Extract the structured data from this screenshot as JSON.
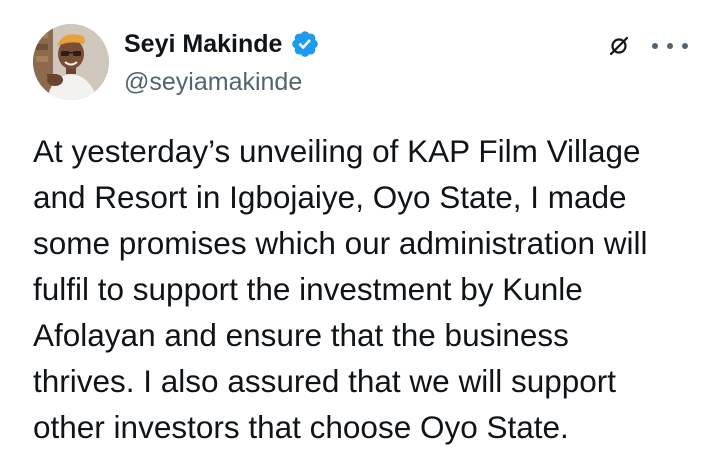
{
  "author": {
    "name": "Seyi Makinde",
    "handle": "@seyiamakinde",
    "verified": true,
    "verified_color": "#1d9bf0"
  },
  "actions": {
    "grok_icon": "grok-icon",
    "more_icon": "more-icon"
  },
  "tweet": {
    "lines": [
      "At yesterday’s unveiling of KAP Film Village",
      "and Resort in Igbojaiye, Oyo State, I made",
      "some promises which our administration will",
      "fulfil to support the investment by Kunle",
      "Afolayan and ensure that the business",
      "thrives. I also assured that we will support",
      "other investors that choose Oyo State."
    ]
  },
  "colors": {
    "text": "#0f1419",
    "secondary": "#536471",
    "accent": "#1d9bf0"
  }
}
